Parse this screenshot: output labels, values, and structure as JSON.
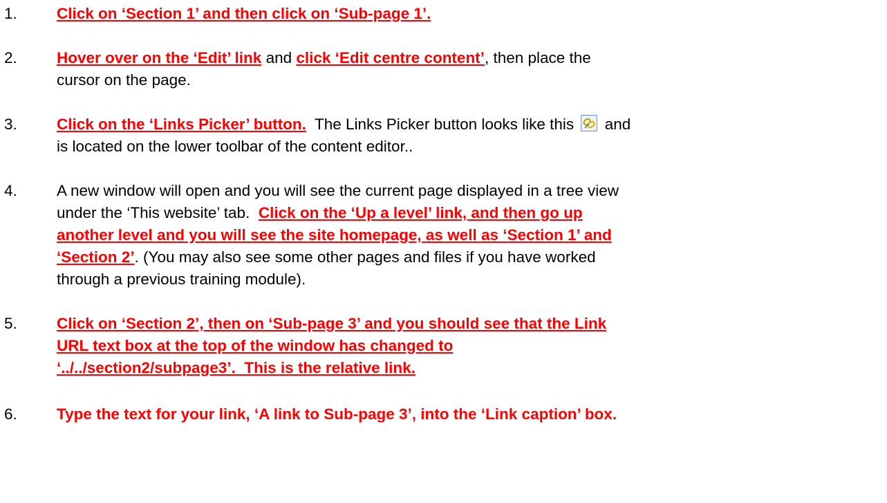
{
  "steps": [
    {
      "number": "1.",
      "parts": [
        {
          "text": "Click on ‘Section 1’ and then click on ‘Sub-page 1’."
        }
      ]
    },
    {
      "number": "2.",
      "parts": [
        {
          "text": "Hover over on the ‘Edit’ link"
        },
        {
          "text": " and "
        },
        {
          "text": "click ‘Edit centre content’"
        },
        {
          "text": ", then place the"
        },
        {
          "text": "cursor on the page."
        }
      ]
    },
    {
      "number": "3.",
      "parts": [
        {
          "text": "Click on the ‘Links Picker’ button."
        },
        {
          "text": "  The Links Picker button looks like this "
        },
        {
          "text": " and"
        },
        {
          "text": "is located on the lower toolbar of the content editor.."
        }
      ]
    },
    {
      "number": "4.",
      "parts": [
        {
          "text": "A new window will open and you will see the current page displayed in a tree view"
        },
        {
          "text": "under the ‘This website’ tab.  "
        },
        {
          "text": "Click on the ‘Up a level’ link, and then go up"
        },
        {
          "text": "another level and you will see the site homepage, as well as ‘Section 1’ and"
        },
        {
          "text": "‘Section 2’"
        },
        {
          "text": ". (You may also see some other pages and files if you have worked"
        },
        {
          "text": "through a previous training module)."
        }
      ]
    },
    {
      "number": "5.",
      "parts": [
        {
          "text": "Click on ‘Section 2’, then on ‘Sub-page 3’ and you should see that the Link"
        },
        {
          "text": "URL text box at the top of the window has changed to"
        },
        {
          "text": "‘../../section2/subpage3’.  This is the relative link."
        }
      ]
    },
    {
      "number": "6.",
      "parts": [
        {
          "text": "Type the text for your link, ‘A link to Sub-page 3’, into the ‘Link caption’ box."
        }
      ]
    }
  ],
  "icons": {
    "links_picker": "links-picker-icon"
  },
  "colors": {
    "emphasis": "#ff0000",
    "text": "#000000"
  }
}
